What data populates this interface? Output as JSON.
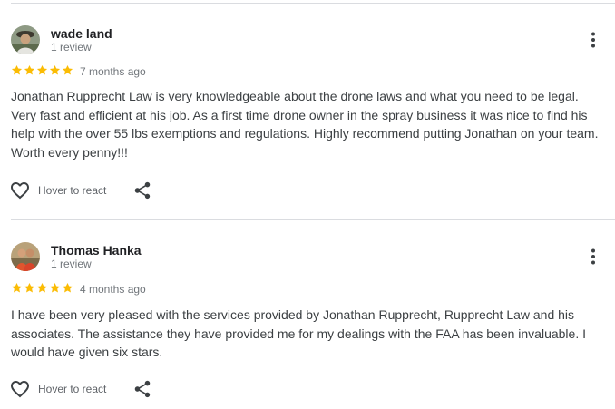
{
  "reviews": [
    {
      "author": "wade land",
      "review_count": "1 review",
      "rating": 5,
      "time_ago": "7 months ago",
      "text": "Jonathan Rupprecht Law is very knowledgeable about the drone laws and what you need to be legal. Very fast and efficient at his job. As a first time drone owner in the spray business it was nice to find his help with the over 55 lbs exemptions and regulations. Highly recommend putting Jonathan on your team. Worth every penny!!!",
      "react_label": "Hover to react"
    },
    {
      "author": "Thomas Hanka",
      "review_count": "1 review",
      "rating": 5,
      "time_ago": "4 months ago",
      "text": "I have been very pleased with the services provided by Jonathan Rupprecht, Rupprecht Law and his associates. The assistance they have provided me for my dealings with the FAA has been invaluable. I would have given six stars.",
      "react_label": "Hover to react"
    }
  ],
  "colors": {
    "star": "#fbbc04",
    "secondary_text": "#70757a",
    "divider": "#dadce0"
  },
  "icons": {
    "more": "more-vert-icon",
    "react": "heart-outline-icon",
    "share": "share-icon",
    "rating": "star-icon"
  }
}
